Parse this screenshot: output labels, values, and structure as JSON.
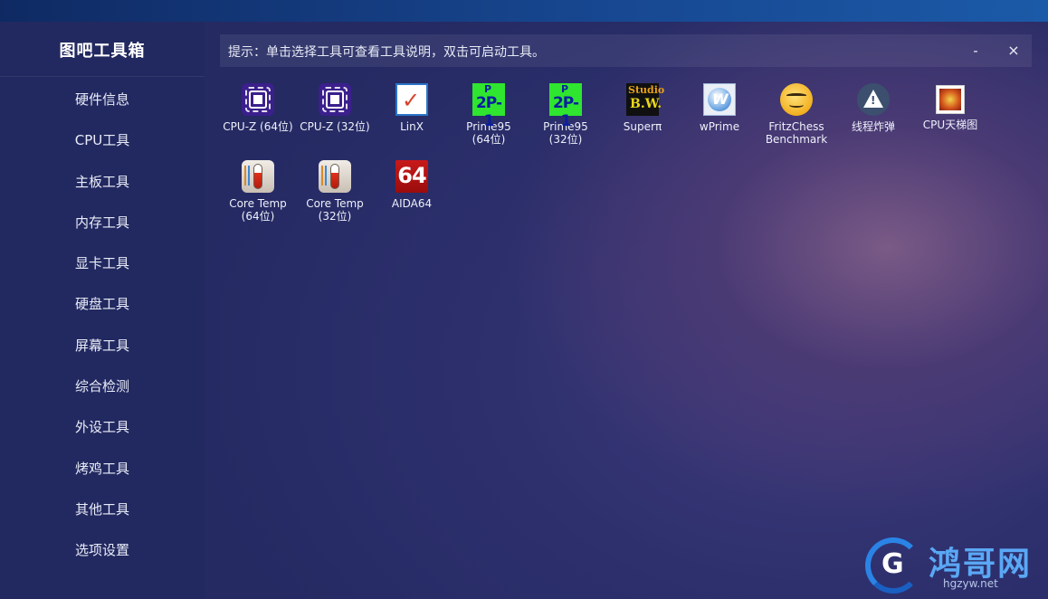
{
  "app": {
    "title": "图吧工具箱"
  },
  "sidebar": {
    "items": [
      {
        "label": "硬件信息"
      },
      {
        "label": "CPU工具"
      },
      {
        "label": "主板工具"
      },
      {
        "label": "内存工具"
      },
      {
        "label": "显卡工具"
      },
      {
        "label": "硬盘工具"
      },
      {
        "label": "屏幕工具"
      },
      {
        "label": "综合检测"
      },
      {
        "label": "外设工具"
      },
      {
        "label": "烤鸡工具"
      },
      {
        "label": "其他工具"
      },
      {
        "label": "选项设置"
      }
    ]
  },
  "hint": {
    "text": "提示：单击选择工具可查看工具说明，双击可启动工具。"
  },
  "window_controls": {
    "minimize": "-",
    "close": "×"
  },
  "tools": [
    {
      "label": "CPU-Z (64位)",
      "icon": "cpu-z-icon"
    },
    {
      "label": "CPU-Z (32位)",
      "icon": "cpu-z-icon"
    },
    {
      "label": "LinX",
      "icon": "linx-checkbox-icon"
    },
    {
      "label": "Prime95\n(64位)",
      "icon": "prime95-icon",
      "p": "P",
      "formula": "2P-1"
    },
    {
      "label": "Prime95\n(32位)",
      "icon": "prime95-icon",
      "p": "P",
      "formula": "2P-1"
    },
    {
      "label": "Superπ",
      "icon": "superpi-icon",
      "t1": "Studio",
      "t2": "B.W."
    },
    {
      "label": "wPrime",
      "icon": "wprime-icon",
      "w": "W"
    },
    {
      "label": "FritzChess\nBenchmark",
      "icon": "fritz-smiley-icon"
    },
    {
      "label": "线程炸弹",
      "icon": "warning-icon",
      "ex": "!"
    },
    {
      "label": "CPU天梯图",
      "icon": "cpu-ladder-icon"
    },
    {
      "label": "Core Temp\n(64位)",
      "icon": "thermometer-icon"
    },
    {
      "label": "Core Temp\n(32位)",
      "icon": "thermometer-icon"
    },
    {
      "label": "AIDA64",
      "icon": "aida64-icon",
      "num": "64"
    }
  ],
  "watermark": {
    "name": "鸿哥网",
    "url": "hgzyw.net",
    "logo_letter": "G"
  }
}
